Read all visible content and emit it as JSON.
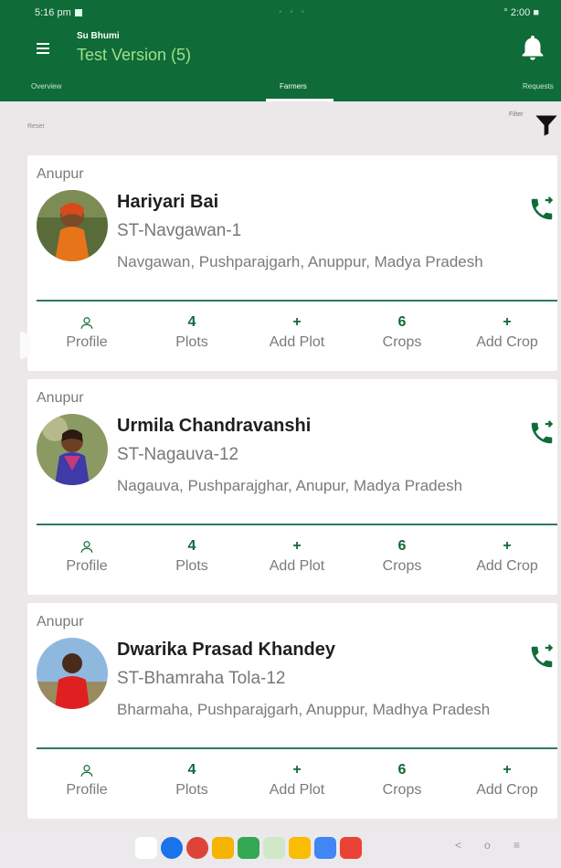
{
  "status_bar": {
    "time": "5:16 pm",
    "right": "° 2:00 ■"
  },
  "app_bar": {
    "app_name": "Su Bhumi",
    "subtitle": "Test Version (5)"
  },
  "tabs": [
    {
      "label": "Overview",
      "active": false
    },
    {
      "label": "Farmers",
      "active": true
    },
    {
      "label": "Requests",
      "active": false
    }
  ],
  "filter_bar": {
    "reset_label": "Reset",
    "filter_label": "Filter"
  },
  "farmers": [
    {
      "district": "Anupur",
      "name": "Hariyari Bai",
      "code": "ST-Navgawan-1",
      "address": "Navgawan, Pushparajgarh, Anuppur, Madya Pradesh",
      "plots_count": "4",
      "crops_count": "6"
    },
    {
      "district": "Anupur",
      "name": "Urmila Chandravanshi",
      "code": "ST-Nagauva-12",
      "address": "Nagauva, Pushparajghar, Anupur, Madya Pradesh",
      "plots_count": "4",
      "crops_count": "6"
    },
    {
      "district": "Anupur",
      "name": "Dwarika Prasad Khandey",
      "code": "ST-Bhamraha Tola-12",
      "address": "Bharmaha, Pushparajgarh, Anuppur, Madhya Pradesh",
      "plots_count": "4",
      "crops_count": "6"
    }
  ],
  "actions": {
    "profile_label": "Profile",
    "plots_label": "Plots",
    "add_plot_label": "Add Plot",
    "crops_label": "Crops",
    "add_crop_label": "Add Crop",
    "add_symbol": "+"
  },
  "nav": {
    "back": "<",
    "home": "o",
    "recents": "≡"
  },
  "icons": {
    "menu": "menu-icon",
    "bell": "bell-icon",
    "filter": "filter-icon",
    "call": "phone-forward-icon",
    "profile": "profile-icon"
  },
  "colors": {
    "brand_green": "#0f6b38",
    "accent_light_green": "#9ee089",
    "divider_green": "#2e7d57"
  }
}
